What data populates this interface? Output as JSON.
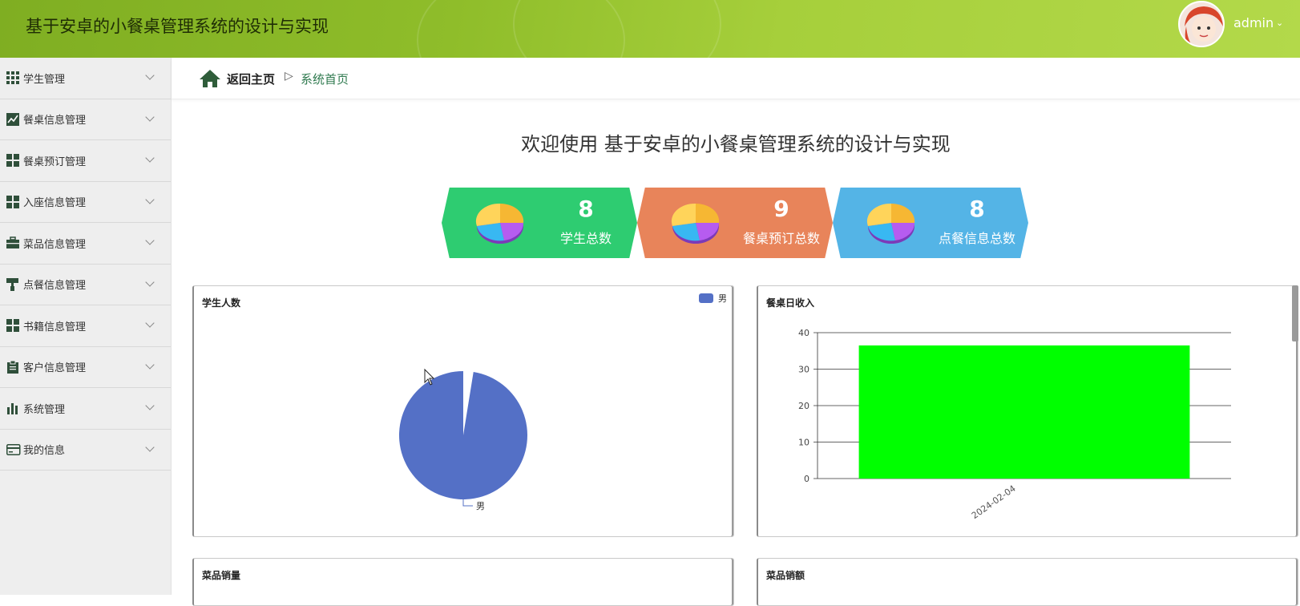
{
  "header": {
    "app_title": "基于安卓的小餐桌管理系统的设计与实现",
    "user_name": "admin",
    "user_caret": "⌄"
  },
  "sidebar": {
    "items": [
      {
        "label": "学生管理",
        "icon": "grid-icon"
      },
      {
        "label": "餐桌信息管理",
        "icon": "line-chart-icon"
      },
      {
        "label": "餐桌预订管理",
        "icon": "tiles-icon"
      },
      {
        "label": "入座信息管理",
        "icon": "tiles-icon"
      },
      {
        "label": "菜品信息管理",
        "icon": "briefcase-icon"
      },
      {
        "label": "点餐信息管理",
        "icon": "paint-roller-icon"
      },
      {
        "label": "书籍信息管理",
        "icon": "tiles-icon"
      },
      {
        "label": "客户信息管理",
        "icon": "clipboard-icon"
      },
      {
        "label": "系统管理",
        "icon": "bar-chart-icon"
      },
      {
        "label": "我的信息",
        "icon": "card-icon"
      }
    ]
  },
  "breadcrumb": {
    "home": "返回主页",
    "separator": "▷",
    "current": "系统首页"
  },
  "welcome": "欢迎使用 基于安卓的小餐桌管理系统的设计与实现",
  "stats": [
    {
      "value": "8",
      "caption": "学生总数",
      "color": "#2ecc71"
    },
    {
      "value": "9",
      "caption": "餐桌预订总数",
      "color": "#e8845a"
    },
    {
      "value": "8",
      "caption": "点餐信息总数",
      "color": "#54b4e6"
    }
  ],
  "panels": {
    "student_count": "学生人数",
    "table_income": "餐桌日收入",
    "dish_sales_qty": "菜品销量",
    "dish_sales_amount": "菜品销额"
  },
  "chart_data": [
    {
      "type": "pie",
      "title": "学生人数",
      "legend": [
        "男"
      ],
      "slices": [
        {
          "name": "男",
          "value": 8
        }
      ],
      "colors": [
        "#5470c6"
      ]
    },
    {
      "type": "bar",
      "title": "餐桌日收入",
      "categories": [
        "2024-02-04"
      ],
      "values": [
        36.5
      ],
      "ylim": [
        0,
        40
      ],
      "yticks": [
        0,
        10,
        20,
        30,
        40
      ],
      "grid": true,
      "bar_color": "#00ff00"
    }
  ]
}
